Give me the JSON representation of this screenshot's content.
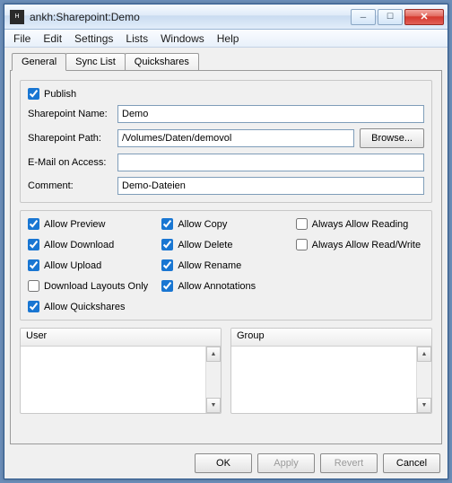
{
  "window": {
    "title": "ankh:Sharepoint:Demo"
  },
  "menu": {
    "file": "File",
    "edit": "Edit",
    "settings": "Settings",
    "lists": "Lists",
    "windows": "Windows",
    "help": "Help"
  },
  "tabs": {
    "general": "General",
    "synclist": "Sync List",
    "quickshares": "Quickshares"
  },
  "fields": {
    "publish_label": "Publish",
    "name_label": "Sharepoint Name:",
    "name_value": "Demo",
    "path_label": "Sharepoint Path:",
    "path_value": "/Volumes/Daten/demovol",
    "browse_label": "Browse...",
    "email_label": "E-Mail on Access:",
    "email_value": "",
    "comment_label": "Comment:",
    "comment_value": "Demo-Dateien"
  },
  "perms": {
    "allow_preview": "Allow Preview",
    "allow_download": "Allow Download",
    "allow_upload": "Allow Upload",
    "download_layouts": "Download Layouts Only",
    "allow_quickshares": "Allow Quickshares",
    "allow_copy": "Allow Copy",
    "allow_delete": "Allow Delete",
    "allow_rename": "Allow Rename",
    "allow_annotations": "Allow Annotations",
    "always_reading": "Always Allow Reading",
    "always_rw": "Always Allow Read/Write"
  },
  "lists": {
    "user": "User",
    "group": "Group"
  },
  "buttons": {
    "ok": "OK",
    "apply": "Apply",
    "revert": "Revert",
    "cancel": "Cancel"
  }
}
